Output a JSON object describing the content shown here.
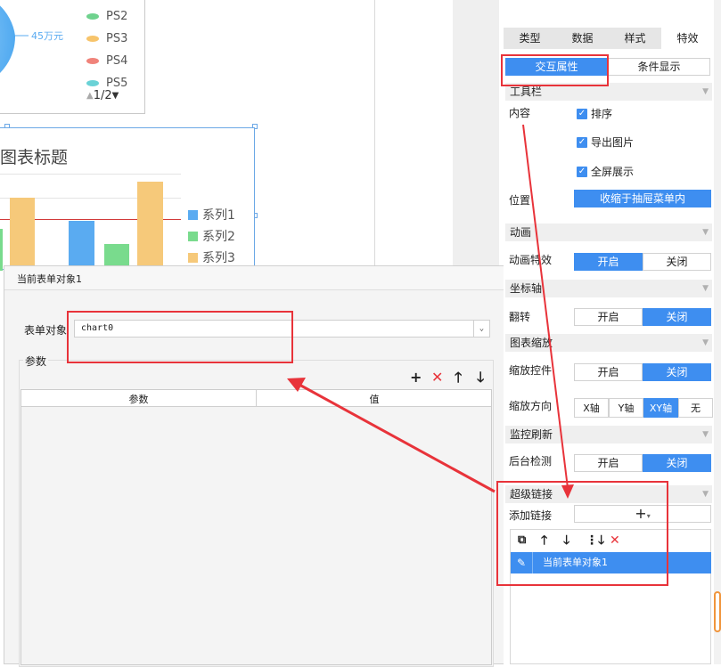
{
  "pie_widget": {
    "data_label": "45万元",
    "legend": [
      {
        "label": "PS2",
        "color": "#6fd28e"
      },
      {
        "label": "PS3",
        "color": "#f7c46b"
      },
      {
        "label": "PS4",
        "color": "#f0837a"
      },
      {
        "label": "PS5",
        "color": "#6ad2d6"
      }
    ],
    "pager": "1/2"
  },
  "bar_widget": {
    "title": "图表标题",
    "legend": [
      {
        "label": "系列1",
        "color": "#5aabf1"
      },
      {
        "label": "系列2",
        "color": "#79db8d"
      },
      {
        "label": "系列3",
        "color": "#f6c97a"
      }
    ]
  },
  "dialog": {
    "title": "当前表单对象1",
    "form_object_label": "表单对象",
    "form_object_value": "chart0",
    "params_label": "参数",
    "table_headers": [
      "参数",
      "值"
    ]
  },
  "right_panel": {
    "tabs": [
      "类型",
      "数据",
      "样式",
      "特效"
    ],
    "active_tab": "特效",
    "subtabs": [
      "交互属性",
      "条件显示"
    ],
    "toolbar_section": "工具栏",
    "content_label": "内容",
    "checkboxes": [
      "排序",
      "导出图片",
      "全屏展示"
    ],
    "position_label": "位置",
    "position_value": "收缩于抽屉菜单内",
    "animation_section": "动画",
    "animation_effect_label": "动画特效",
    "axis_section": "坐标轴",
    "flip_label": "翻转",
    "zoom_section": "图表缩放",
    "zoom_control_label": "缩放控件",
    "zoom_direction_label": "缩放方向",
    "zoom_directions": [
      "X轴",
      "Y轴",
      "XY轴",
      "无"
    ],
    "monitor_section": "监控刷新",
    "background_check_label": "后台检测",
    "on_label": "开启",
    "off_label": "关闭",
    "hyperlink_section": "超级链接",
    "add_link_label": "添加链接",
    "link_item": "当前表单对象1"
  },
  "colors": {
    "accent": "#3e8ef0",
    "annotation_red": "#e8333a"
  }
}
